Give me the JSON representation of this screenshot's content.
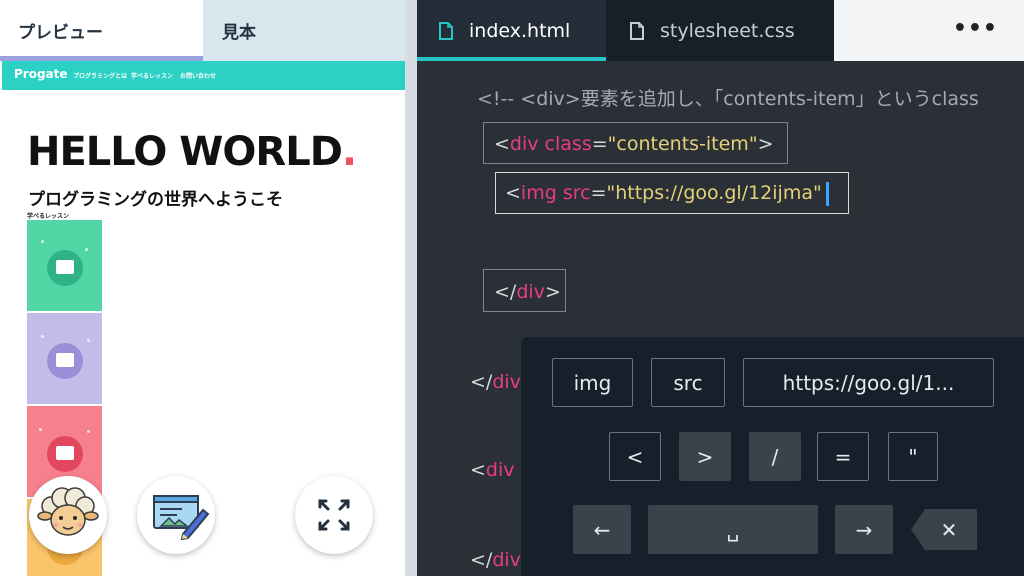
{
  "left_tabs": {
    "preview": "プレビュー",
    "sample": "見本"
  },
  "site": {
    "logo": "Progate",
    "nav": [
      "プログラミングとは",
      "学べるレッスン",
      "お問い合わせ"
    ],
    "hero": "HELLO WORLD",
    "hero_dot": ".",
    "subtitle": "プログラミングの世界へようこそ",
    "lessons_label": "学べるレッスン"
  },
  "editor_tabs": {
    "active": "index.html",
    "inactive": "stylesheet.css",
    "more": "•••"
  },
  "code": {
    "comment": "<!-- <div>要素を追加し、「contents-item」というclass",
    "line_div": {
      "open": "<",
      "tag": "div",
      "attr": " class",
      "eq": "=",
      "value": "\"contents-item\"",
      "close": ">"
    },
    "line_img": {
      "open": "<",
      "tag": "img",
      "attr": " src",
      "eq": "=",
      "value": "\"https://goo.gl/12ijma\""
    },
    "line_enddiv": {
      "open": "</",
      "tag": "div",
      "close": ">"
    },
    "line_enddiv2": {
      "open": "</",
      "tag": "div"
    },
    "line_div2": {
      "open": "<",
      "tag": "div c"
    },
    "line_enddiv3": {
      "open": "</",
      "tag": "div"
    }
  },
  "keyboard": {
    "row1": [
      "img",
      "src",
      "https://goo.gl/1..."
    ],
    "row2": [
      "<",
      ">",
      "/",
      "=",
      "\""
    ],
    "left_arrow": "←",
    "space": "␣",
    "right_arrow": "→",
    "delete": "✕"
  },
  "colors": {
    "accent": "#28c3c4",
    "tag": "#ea3d81",
    "string": "#e3d277",
    "site_header": "#2ad1c4",
    "hero_dot": "#f0535b"
  },
  "icons": [
    "file-icon",
    "sheep-icon",
    "editor-illustration-icon",
    "expand-icon"
  ]
}
